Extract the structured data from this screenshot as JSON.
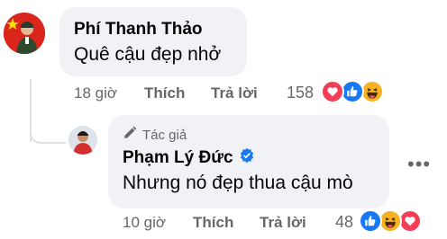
{
  "comment": {
    "author": "Phí Thanh Thảo",
    "text": "Quê cậu đẹp nhở",
    "time": "18 giờ",
    "like_label": "Thích",
    "reply_label": "Trả lời",
    "reaction_count": "158",
    "reactions": [
      "love-icon",
      "like-icon",
      "haha-icon"
    ]
  },
  "reply": {
    "author_badge": "Tác giả",
    "author": "Phạm Lý Đức",
    "text": "Nhưng nó đẹp thua cậu mò",
    "time": "10 giờ",
    "like_label": "Thích",
    "reply_label": "Trả lời",
    "reaction_count": "48",
    "reactions": [
      "like-icon",
      "haha-icon",
      "love-icon"
    ],
    "more_label": "•••"
  },
  "colors": {
    "bubble": "#f0f2f5",
    "secondary_text": "#65676b",
    "like_blue": "#1877f2",
    "love_red": "#f33e58",
    "haha_yellow": "#f7b125"
  }
}
